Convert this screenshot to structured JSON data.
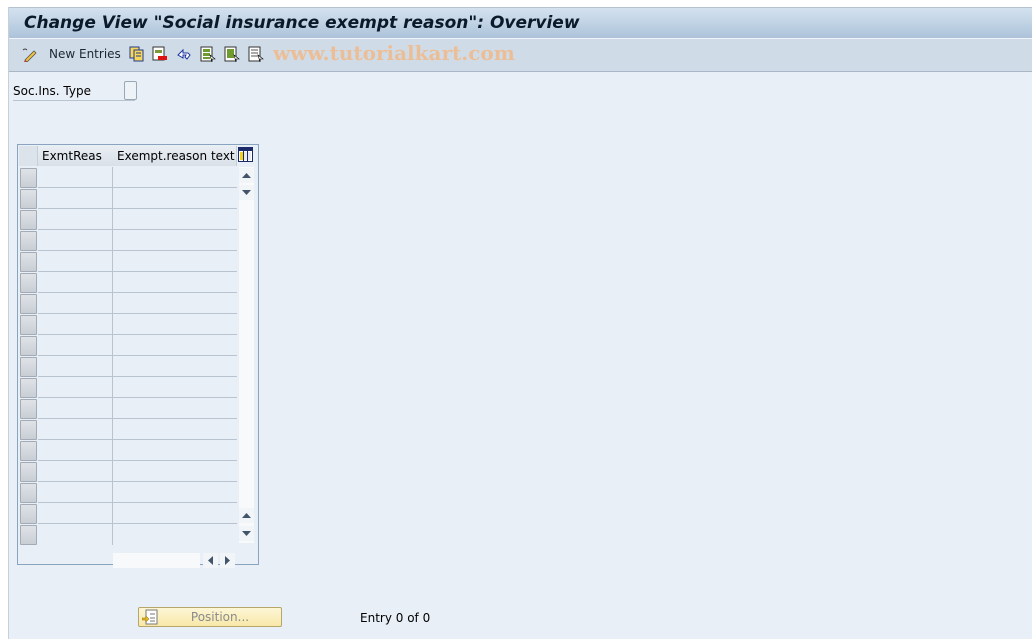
{
  "window": {
    "title": "Change View \"Social insurance exempt reason\": Overview"
  },
  "toolbar": {
    "items": [
      {
        "icon": "display-change-icon",
        "label": ""
      },
      {
        "icon": "new-entries-label",
        "label": "New Entries"
      },
      {
        "icon": "copy-as-icon",
        "label": ""
      },
      {
        "icon": "delete-icon",
        "label": ""
      },
      {
        "icon": "undo-change-icon",
        "label": ""
      },
      {
        "icon": "select-all-icon",
        "label": ""
      },
      {
        "icon": "select-block-icon",
        "label": ""
      },
      {
        "icon": "deselect-all-icon",
        "label": ""
      }
    ],
    "new_entries_label": "New Entries",
    "watermark": "www.tutorialkart.com"
  },
  "header_fields": {
    "soc_ins_type_label": "Soc.Ins. Type",
    "soc_ins_type_value": ""
  },
  "table": {
    "columns": [
      "ExmtReas",
      "Exempt.reason text"
    ],
    "row_count": 18,
    "rows": []
  },
  "footer": {
    "position_button_label": "Position...",
    "entry_info": "Entry 0 of 0"
  },
  "colors": {
    "background": "#e8eff7",
    "title_bar": "#adc3da",
    "toolbar": "#cfdce7",
    "watermark": "#f2b98a",
    "position_button": "#f8e8a8"
  }
}
